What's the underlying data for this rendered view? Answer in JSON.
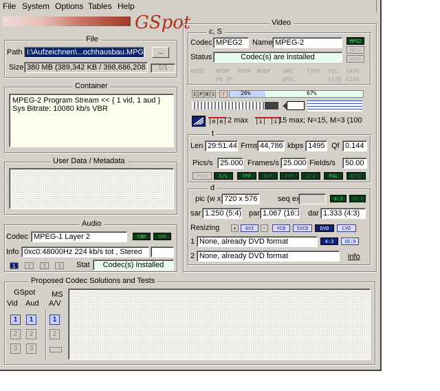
{
  "menu": [
    "File",
    "System",
    "Options",
    "Tables",
    "Help"
  ],
  "logo": "GSpot",
  "file": {
    "title": "File",
    "path_label": "Path",
    "path_value": "I:\\Aufzeichnen\\...ochhausbau.MPG",
    "browse_label": "...",
    "size_label": "Size",
    "size_value": "380 MB (389,342 KB / 398,686,208",
    "counter": "1/1"
  },
  "container": {
    "title": "Container",
    "text": "MPEG-2 Program Stream << { 1 vid, 1 aud }\nSys Bitrate: 10080 kb/s VBR"
  },
  "metadata": {
    "title": "User Data / Metadata"
  },
  "audio": {
    "title": "Audio",
    "codec_label": "Codec",
    "codec_value": "MPEG-1 Layer 2",
    "cbr": "CBR",
    "vbr": "VBR",
    "info_label": "Info",
    "info_value": "0xc0:48000Hz  224 kb/s tot , Stereo",
    "stream_buttons": [
      "1",
      "2",
      "3",
      "4"
    ],
    "stat_label": "Stat",
    "stat_value": "Codec(s) Installed"
  },
  "video": {
    "title": "Video",
    "cs_title": "c, S",
    "codec_label": "Codec",
    "codec_value": "MPEG2",
    "name_label": "Name",
    "name_value": "MPEG-2",
    "status_label": "Status",
    "status_value": "Codec(s) are Installed",
    "codec_badges": [
      {
        "label": "MPG2",
        "active": true
      },
      {
        "label": "MPG4",
        "active": false
      },
      {
        "label": "H264",
        "active": false
      }
    ],
    "flags_row1": [
      "AVID",
      "NVOP",
      "PVOP",
      "BVOP",
      "GMC",
      "I709",
      "FCC",
      "I470"
    ],
    "flags_row2": [
      "PB",
      "DF",
      "QPEL",
      "S170",
      "S240"
    ],
    "frame_types": [
      "I",
      "P",
      "B",
      "S"
    ],
    "bar_marker": "7",
    "bar_pct1": "26%",
    "bar_pct2": "67%",
    "bframes": "2 max",
    "gop": "15 max; N=15, M=3 (100",
    "t_title": "t",
    "len_label": "Len",
    "len_value": "29:51.44",
    "frms_label": "Frms",
    "frms_value": "44,786",
    "kbps_label": "kbps",
    "kbps_value": "1495",
    "qf_label": "Qf",
    "qf_value": "0.144",
    "pics_label": "Pics/s",
    "pics_value": "25.000",
    "frames_label": "Frames/s",
    "frames_value": "25.000",
    "fields_label": "Fields/s",
    "fields_value": "50.00",
    "t_badges": [
      {
        "label": "PROG",
        "active": false
      },
      {
        "label": "I/L",
        "active": true
      },
      {
        "label": "TFF",
        "active": true
      },
      {
        "label": "BFF",
        "active": false
      },
      {
        "label": "PFF",
        "active": false
      },
      {
        "label": "3:2",
        "active": false
      },
      {
        "label": "PAL",
        "active": true
      },
      {
        "label": "NTSC",
        "active": false
      }
    ],
    "d_title": "d",
    "pic_label": "pic (w x",
    "pic_value": "720 x 576",
    "seqext_label": "seq ext",
    "ratio_badges": [
      {
        "label": "4:3",
        "active": true
      },
      {
        "label": "16:9",
        "active": false
      }
    ],
    "sar_label": "sar",
    "sar_value": "1.250 (5:4)",
    "par_label": "par",
    "par_value": "1.067 (16:1",
    "dar_label": "dar",
    "dar_value": "1.333 (4:3)",
    "resizing_label": "Resizing",
    "resize_badges": [
      "+",
      "AVI",
      "-",
      "VCD",
      "SVCD",
      "DVD",
      "CVD"
    ],
    "resize1_num": "1",
    "resize1_value": "None, already DVD format",
    "resize2_num": "2",
    "resize2_value": "None, already DVD format",
    "resize_ratio_badges": [
      "4:3",
      "16:9"
    ],
    "info_link": "info"
  },
  "proposed": {
    "title": "Proposed Codec Solutions and Tests",
    "gspot_label": "GSpot",
    "vid_label": "Vid",
    "aud_label": "Aud",
    "ms_label": "MS",
    "av_label": "A/V",
    "numbers": [
      "1",
      "2",
      "3"
    ]
  },
  "colors": {
    "window_bg": "#d4d0c8",
    "highlight": "#0a246a",
    "status_green": "#e8fcef",
    "badge_active": "#0c3a18",
    "logo_red": "#b03020"
  }
}
